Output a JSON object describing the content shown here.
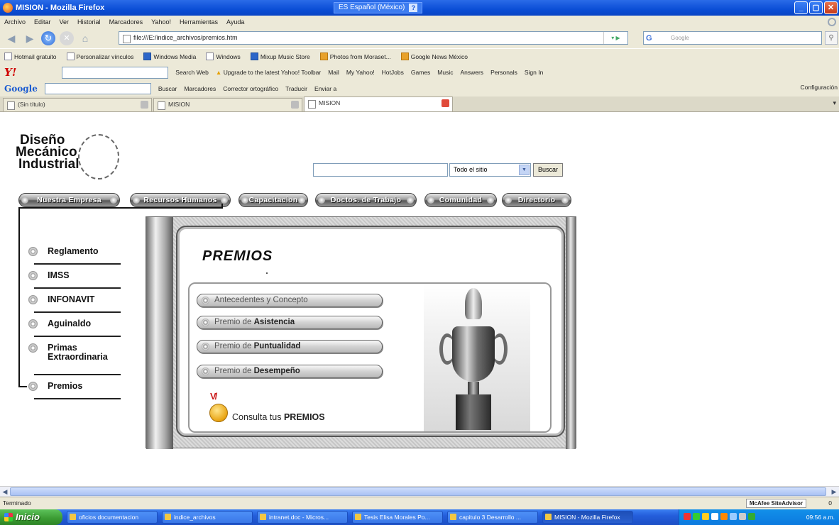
{
  "window": {
    "title": "MISION - Mozilla Firefox",
    "language_indicator": "ES Español (México)",
    "help_glyph": "?",
    "controls": {
      "minimize": "_",
      "maximize": "▢",
      "close": "✕"
    }
  },
  "menubar": {
    "items": [
      "Archivo",
      "Editar",
      "Ver",
      "Historial",
      "Marcadores",
      "Yahoo!",
      "Herramientas",
      "Ayuda"
    ]
  },
  "navigation": {
    "url": "file:///E:/indice_archivos/premios.htm",
    "search_placeholder": "Google",
    "search_engine_glyph": "G",
    "back": "◀",
    "forward": "▶",
    "home": "⌂",
    "reload": "↻",
    "stop": "✕",
    "url_dropdown": "▾ ▶"
  },
  "bookmarks": {
    "items": [
      "Hotmail gratuito",
      "Personalizar vínculos",
      "Windows Media",
      "Windows",
      "Mixup Music Store",
      "Photos from Moraset...",
      "Google News México"
    ]
  },
  "yahoo_toolbar": {
    "logo": "Y!",
    "items": [
      "Search Web",
      "Upgrade to the latest Yahoo! Toolbar",
      "Mail",
      "My Yahoo!",
      "HotJobs",
      "Games",
      "Music",
      "Answers",
      "Personals",
      "Sign In"
    ]
  },
  "google_toolbar": {
    "logo": "Google",
    "items": [
      "Buscar",
      "Marcadores",
      "Corrector ortográfico",
      "Traducir",
      "Enviar a"
    ],
    "settings": "Configuración"
  },
  "tabs": {
    "items": [
      {
        "label": "(Sin título)",
        "active": false
      },
      {
        "label": "MISION",
        "active": false
      },
      {
        "label": "MISION",
        "active": true
      }
    ],
    "overflow": "▾"
  },
  "site": {
    "logo_lines": [
      "Diseño",
      "Mecánico",
      "Industrial"
    ],
    "search": {
      "scope": "Todo el sitio",
      "button": "Buscar"
    },
    "topnav": [
      "Nuestra Empresa",
      "Recursos Humanos",
      "Capacitacion",
      "Doctos. de Trabajo",
      "Comunidad",
      "Directorio"
    ],
    "sidenav": [
      "Reglamento",
      "IMSS",
      "INFONAVIT",
      "Aguinaldo",
      "Primas Extraordinaria",
      "Premios"
    ],
    "content": {
      "heading": "PREMIOS",
      "awards": [
        {
          "prefix": "Antecedentes y Concepto",
          "bold": ""
        },
        {
          "prefix": "Premio de ",
          "bold": "Asistencia"
        },
        {
          "prefix": "Premio de ",
          "bold": "Puntualidad"
        },
        {
          "prefix": "Premio de ",
          "bold": "Desempeño"
        }
      ],
      "consulta_prefix": "Consulta tus ",
      "consulta_bold": "PREMIOS",
      "medal_ribbon_v": "V",
      "medal_ribbon_slash": "/"
    }
  },
  "statusbar": {
    "text": "Terminado",
    "mcafee": "McAfee SiteAdvisor",
    "counter": "0"
  },
  "taskbar": {
    "start": "Inicio",
    "buttons": [
      {
        "label": "oficios documentacion",
        "active": false
      },
      {
        "label": "indice_archivos",
        "active": false
      },
      {
        "label": "intranet.doc - Micros...",
        "active": false
      },
      {
        "label": "Tesis Elisa Morales Po...",
        "active": false
      },
      {
        "label": "capitulo 3 Desarrollo ...",
        "active": false
      },
      {
        "label": "MISION - Mozilla Firefox",
        "active": true
      }
    ],
    "clock": "09:56 a.m."
  },
  "colors": {
    "title_bar": "#0b4ed6",
    "taskbar": "#245edb",
    "start_button": "#3a9a32",
    "nav_pill": "#585858",
    "medal_gold": "#e9a413"
  }
}
